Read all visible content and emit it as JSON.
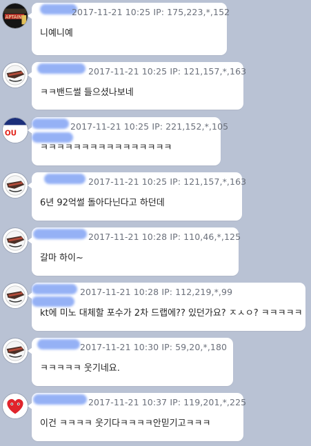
{
  "messages": [
    {
      "ip": "2017-11-21 10:25  IP: 175,223,*,152",
      "text": "니예니예",
      "avatar": "captain-logo-avatar"
    },
    {
      "ip": "2017-11-21 10:25  IP: 121,157,*,163",
      "text": "ㅋㅋ밴드썰 들으셨나보네",
      "avatar": "dinosaurs-logo-avatar"
    },
    {
      "ip": "2017-11-21 10:25  IP: 221,152,*,105",
      "text": "ㅋㅋㅋㅋㅋㅋㅋㅋㅋㅋㅋㅋㅋㅋㅋㅋ",
      "avatar": "team-logo-avatar",
      "avatar_text": "OU"
    },
    {
      "ip": "2017-11-21 10:25  IP: 121,157,*,163",
      "text": "6년 92억썰 돌아다닌다고 하던데",
      "avatar": "dinosaurs-logo-avatar"
    },
    {
      "ip": "2017-11-21 10:28  IP: 110,46,*,125",
      "text": "갈마 하이~",
      "avatar": "dinosaurs-logo-avatar"
    },
    {
      "ip": "2017-11-21 10:28  IP: 112,219,*,99",
      "text": "kt에 미노 대체할 포수가 2차 드랩에?? 있던가요? ㅈㅅㅇ? ㅋㅋㅋㅋㅋ",
      "avatar": "dinosaurs-logo-avatar"
    },
    {
      "ip": "2017-11-21 10:30  IP: 59,20,*,180",
      "text": "ㅋㅋㅋㅋㅋ 웃기네요.",
      "avatar": "dinosaurs-logo-avatar"
    },
    {
      "ip": "2017-11-21 10:37  IP: 119,201,*,225",
      "text": "이건 ㅋㅋㅋㅋ 웃기다ㅋㅋㅋㅋ안믿기고ㅋㅋㅋ",
      "avatar": "heart-logo-avatar"
    }
  ]
}
